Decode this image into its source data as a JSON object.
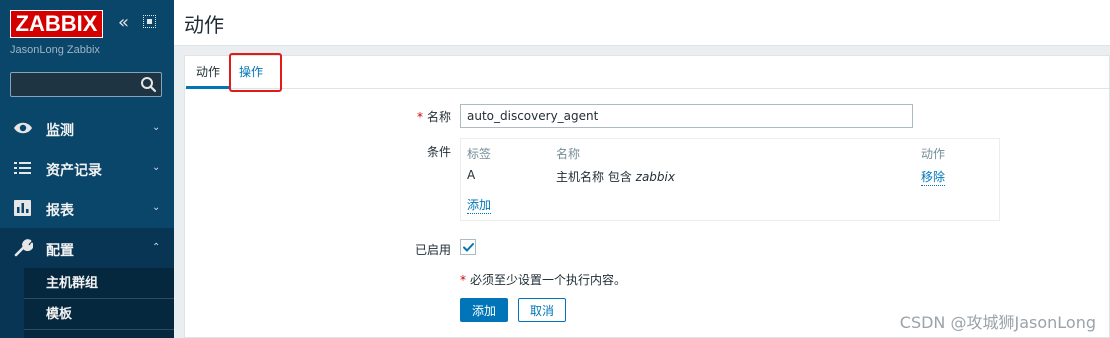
{
  "sidebar": {
    "logo": "ZABBIX",
    "server_name": "JasonLong Zabbix",
    "search": {
      "value": "",
      "placeholder": ""
    },
    "items": [
      {
        "label": "监测",
        "icon": "eye-icon",
        "chevron": "⌄"
      },
      {
        "label": "资产记录",
        "icon": "list-icon",
        "chevron": "⌄"
      },
      {
        "label": "报表",
        "icon": "bar-chart-icon",
        "chevron": "⌄"
      },
      {
        "label": "配置",
        "icon": "wrench-icon",
        "chevron": "⌃"
      }
    ],
    "subitems": [
      {
        "label": "主机群组"
      },
      {
        "label": "模板"
      }
    ]
  },
  "header": {
    "title": "动作"
  },
  "tabs": [
    {
      "label": "动作"
    },
    {
      "label": "操作"
    }
  ],
  "form": {
    "name_label": "名称",
    "name_value": "auto_discovery_agent",
    "conditions_label": "条件",
    "conditions": {
      "headers": [
        "标签",
        "名称",
        "动作"
      ],
      "rows": [
        {
          "label": "A",
          "name_prefix": "主机名称 包含 ",
          "name_value": "zabbix",
          "action": "移除"
        }
      ],
      "add_label": "添加"
    },
    "enabled_label": "已启用",
    "enabled": true,
    "note_star": "*",
    "note": "必须至少设置一个执行内容。",
    "add_button": "添加",
    "cancel_button": "取消"
  },
  "colors": {
    "sidebar_bg": "#0a466a",
    "accent": "#0275b8",
    "logo_red": "#d40000",
    "highlight_red": "#e31a1a"
  },
  "watermark": "CSDN @攻城狮JasonLong"
}
